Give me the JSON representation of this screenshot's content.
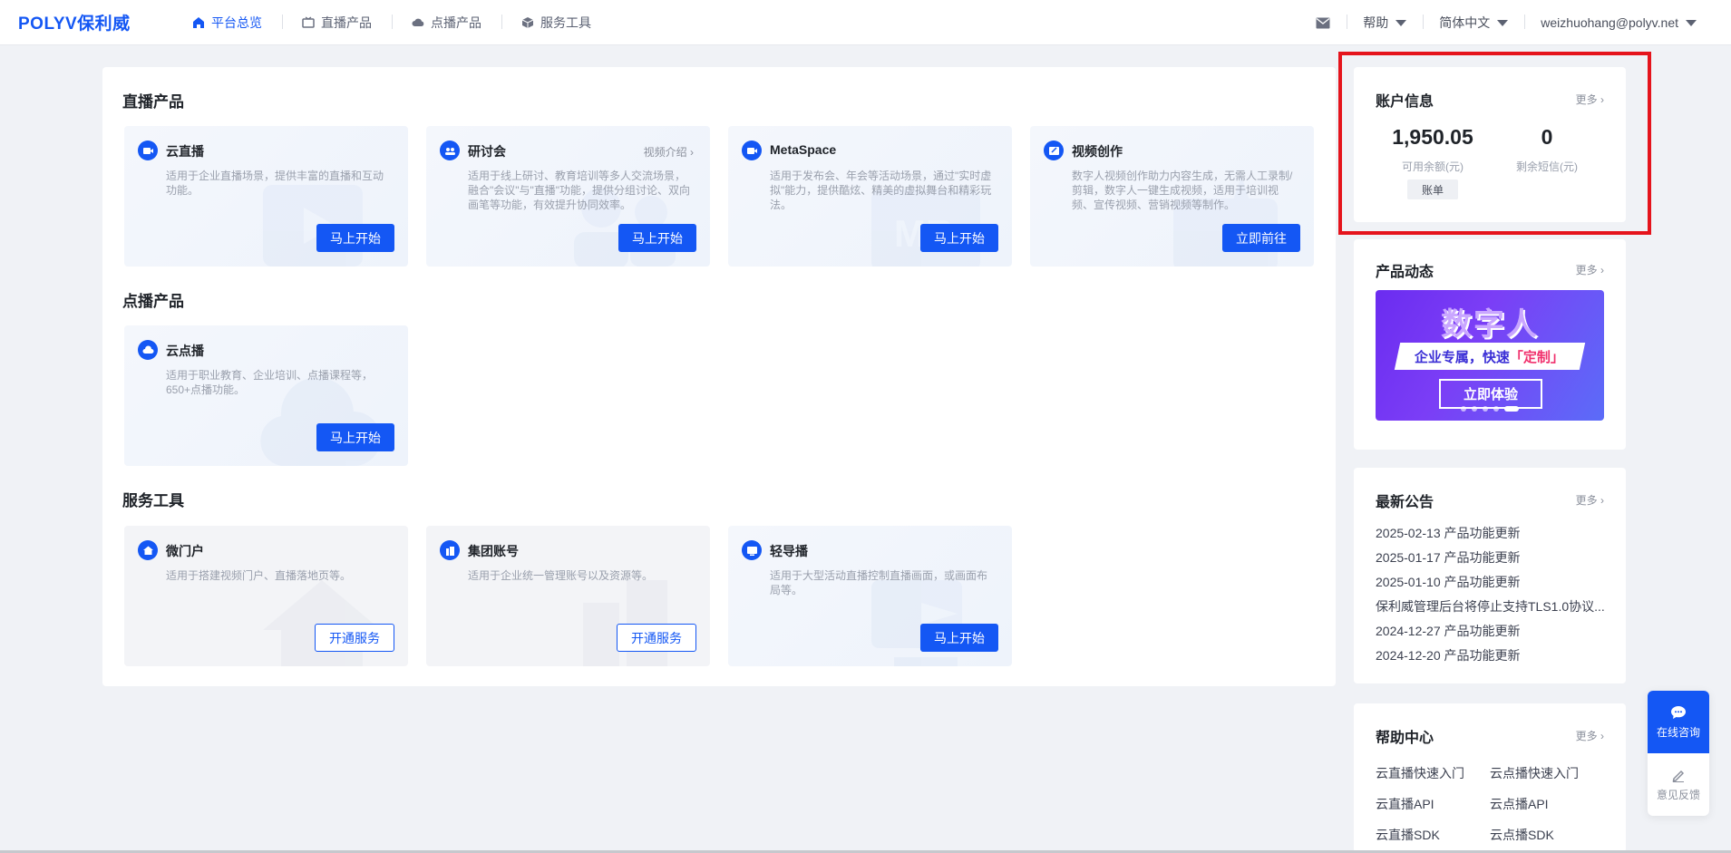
{
  "brand": {
    "logo": "POLYV保利威",
    "accent": "#1457f4"
  },
  "nav": [
    {
      "label": "平台总览",
      "icon": "home-icon",
      "active": true
    },
    {
      "label": "直播产品",
      "icon": "tv-icon",
      "active": false
    },
    {
      "label": "点播产品",
      "icon": "cloud-icon",
      "active": false
    },
    {
      "label": "服务工具",
      "icon": "box-icon",
      "active": false
    }
  ],
  "topright": {
    "help": "帮助",
    "language": "简体中文",
    "user": "weizhuohang@polyv.net"
  },
  "sections": {
    "live": "直播产品",
    "vod": "点播产品",
    "tools": "服务工具"
  },
  "live_cards": [
    {
      "name": "云直播",
      "desc": "适用于企业直播场景，提供丰富的直播和互动功能。",
      "button": "马上开始"
    },
    {
      "name": "研讨会",
      "extra": "视频介绍",
      "desc": "适用于线上研讨、教育培训等多人交流场景，融合\"会议\"与\"直播\"功能，提供分组讨论、双向画笔等功能，有效提升协同效率。",
      "button": "马上开始"
    },
    {
      "name": "MetaSpace",
      "desc": "适用于发布会、年会等活动场景，通过\"实时虚拟\"能力，提供酷炫、精美的虚拟舞台和精彩玩法。",
      "button": "马上开始"
    },
    {
      "name": "视频创作",
      "desc": "数字人视频创作助力内容生成，无需人工录制/剪辑，数字人一键生成视频，适用于培训视频、宣传视频、营销视频等制作。",
      "button": "立即前往"
    }
  ],
  "vod_cards": [
    {
      "name": "云点播",
      "desc": "适用于职业教育、企业培训、点播课程等，650+点播功能。",
      "button": "马上开始"
    }
  ],
  "tool_cards": [
    {
      "name": "微门户",
      "desc": "适用于搭建视频门户、直播落地页等。",
      "button": "开通服务"
    },
    {
      "name": "集团账号",
      "desc": "适用于企业统一管理账号以及资源等。",
      "button": "开通服务"
    },
    {
      "name": "轻导播",
      "desc": "适用于大型活动直播控制直播画面，或画面布局等。",
      "button": "马上开始"
    }
  ],
  "account": {
    "title": "账户信息",
    "more": "更多",
    "balance": "1,950.05",
    "balance_label": "可用余额(元)",
    "sms": "0",
    "sms_label": "剩余短信(元)",
    "bill": "账单"
  },
  "product_news": {
    "title": "产品动态",
    "more": "更多",
    "banner_title": "数字人",
    "banner_line_a": "企业专属，快速",
    "banner_line_b": "「定制」",
    "banner_cta": "立即体验"
  },
  "announcements": {
    "title": "最新公告",
    "more": "更多",
    "items": [
      "2025-02-13 产品功能更新",
      "2025-01-17 产品功能更新",
      "2025-01-10 产品功能更新",
      "保利威管理后台将停止支持TLS1.0协议...",
      "2024-12-27 产品功能更新",
      "2024-12-20 产品功能更新"
    ]
  },
  "help_center": {
    "title": "帮助中心",
    "more": "更多",
    "links": [
      "云直播快速入门",
      "云点播快速入门",
      "云直播API",
      "云点播API",
      "云直播SDK",
      "云点播SDK"
    ]
  },
  "floating": {
    "consult": "在线咨询",
    "feedback": "意见反馈"
  }
}
